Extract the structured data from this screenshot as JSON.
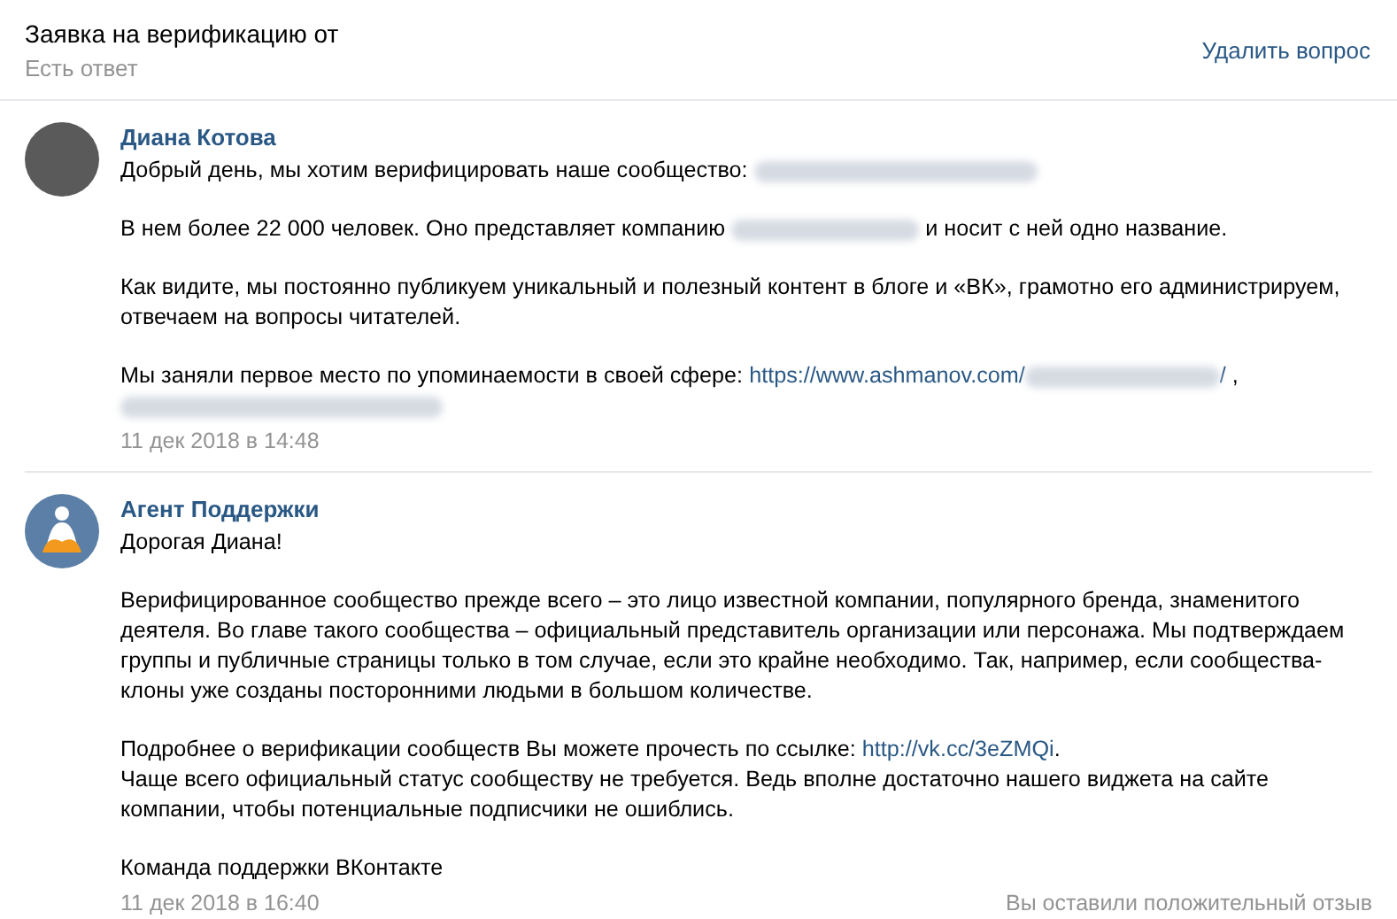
{
  "header": {
    "title": "Заявка на верификацию от",
    "status": "Есть ответ",
    "action": "Удалить вопрос"
  },
  "messages": [
    {
      "author": "Диана Котова",
      "avatar": {
        "kind": "photo"
      },
      "paragraphs": [
        [
          {
            "kind": "text",
            "text": "Добрый день, мы хотим верифицировать наше сообщество: "
          },
          {
            "kind": "redacted"
          }
        ],
        [
          {
            "kind": "text",
            "text": "В нем более 22 000 человек. Оно представляет компанию "
          },
          {
            "kind": "redacted"
          },
          {
            "kind": "text",
            "text": " и носит с ней одно название."
          }
        ],
        [
          {
            "kind": "text",
            "text": "Как видите, мы постоянно публикуем уникальный и полезный контент в блоге и «ВК», грамотно его администрируем, отвечаем на вопросы читателей."
          }
        ],
        [
          {
            "kind": "text",
            "text": "Мы заняли первое место по упоминаемости в своей сфере: "
          },
          {
            "kind": "link",
            "text": "https://www.ashmanov.com/"
          },
          {
            "kind": "redacted"
          },
          {
            "kind": "link",
            "text": "/"
          },
          {
            "kind": "text",
            "text": " ,"
          },
          {
            "kind": "break"
          },
          {
            "kind": "redacted"
          }
        ]
      ],
      "date": "11 дек 2018 в 14:48"
    },
    {
      "author": "Агент Поддержки",
      "avatar": {
        "kind": "agent"
      },
      "paragraphs": [
        [
          {
            "kind": "text",
            "text": "Дорогая Диана!"
          }
        ],
        [
          {
            "kind": "text",
            "text": "Верифицированное сообщество прежде всего – это лицо известной компании, популярного бренда, знаменитого деятеля. Во главе такого сообщества – официальный представитель организации или персонажа. Мы подтверждаем группы и публичные страницы только в том случае, если это крайне необходимо. Так, например, если сообщества-клоны уже созданы посторонними людьми в большом количестве."
          }
        ],
        [
          {
            "kind": "text",
            "text": "Подробнее о верификации сообществ Вы можете прочесть по ссылке: "
          },
          {
            "kind": "link",
            "text": "http://vk.cc/3eZMQi"
          },
          {
            "kind": "text",
            "text": "."
          },
          {
            "kind": "break"
          },
          {
            "kind": "text",
            "text": "Чаще всего официальный статус сообществу не требуется. Ведь вполне достаточно нашего виджета на сайте компании, чтобы потенциальные подписчики не ошиблись."
          }
        ],
        [
          {
            "kind": "text",
            "text": "Команда поддержки ВКонтакте"
          }
        ]
      ],
      "date": "11 дек 2018 в 16:40",
      "feedback": "Вы оставили положительный отзыв"
    }
  ]
}
